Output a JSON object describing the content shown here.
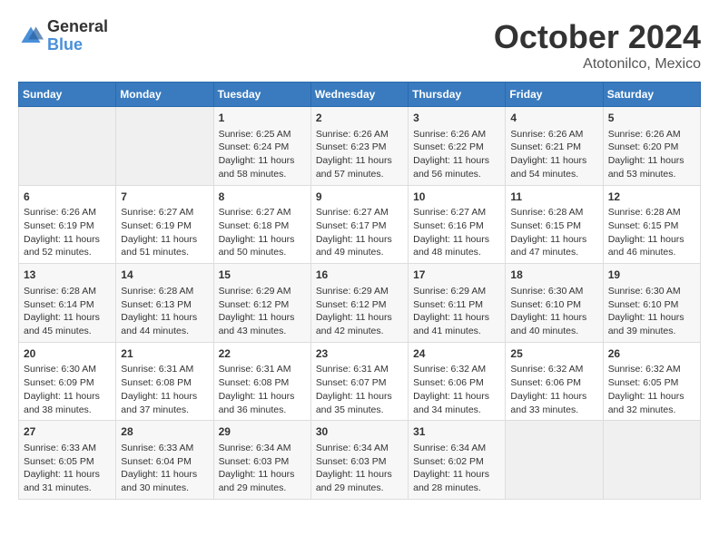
{
  "logo": {
    "general": "General",
    "blue": "Blue"
  },
  "title": "October 2024",
  "location": "Atotonilco, Mexico",
  "days_of_week": [
    "Sunday",
    "Monday",
    "Tuesday",
    "Wednesday",
    "Thursday",
    "Friday",
    "Saturday"
  ],
  "weeks": [
    [
      {
        "day": "",
        "content": ""
      },
      {
        "day": "",
        "content": ""
      },
      {
        "day": "1",
        "content": "Sunrise: 6:25 AM\nSunset: 6:24 PM\nDaylight: 11 hours and 58 minutes."
      },
      {
        "day": "2",
        "content": "Sunrise: 6:26 AM\nSunset: 6:23 PM\nDaylight: 11 hours and 57 minutes."
      },
      {
        "day": "3",
        "content": "Sunrise: 6:26 AM\nSunset: 6:22 PM\nDaylight: 11 hours and 56 minutes."
      },
      {
        "day": "4",
        "content": "Sunrise: 6:26 AM\nSunset: 6:21 PM\nDaylight: 11 hours and 54 minutes."
      },
      {
        "day": "5",
        "content": "Sunrise: 6:26 AM\nSunset: 6:20 PM\nDaylight: 11 hours and 53 minutes."
      }
    ],
    [
      {
        "day": "6",
        "content": "Sunrise: 6:26 AM\nSunset: 6:19 PM\nDaylight: 11 hours and 52 minutes."
      },
      {
        "day": "7",
        "content": "Sunrise: 6:27 AM\nSunset: 6:19 PM\nDaylight: 11 hours and 51 minutes."
      },
      {
        "day": "8",
        "content": "Sunrise: 6:27 AM\nSunset: 6:18 PM\nDaylight: 11 hours and 50 minutes."
      },
      {
        "day": "9",
        "content": "Sunrise: 6:27 AM\nSunset: 6:17 PM\nDaylight: 11 hours and 49 minutes."
      },
      {
        "day": "10",
        "content": "Sunrise: 6:27 AM\nSunset: 6:16 PM\nDaylight: 11 hours and 48 minutes."
      },
      {
        "day": "11",
        "content": "Sunrise: 6:28 AM\nSunset: 6:15 PM\nDaylight: 11 hours and 47 minutes."
      },
      {
        "day": "12",
        "content": "Sunrise: 6:28 AM\nSunset: 6:15 PM\nDaylight: 11 hours and 46 minutes."
      }
    ],
    [
      {
        "day": "13",
        "content": "Sunrise: 6:28 AM\nSunset: 6:14 PM\nDaylight: 11 hours and 45 minutes."
      },
      {
        "day": "14",
        "content": "Sunrise: 6:28 AM\nSunset: 6:13 PM\nDaylight: 11 hours and 44 minutes."
      },
      {
        "day": "15",
        "content": "Sunrise: 6:29 AM\nSunset: 6:12 PM\nDaylight: 11 hours and 43 minutes."
      },
      {
        "day": "16",
        "content": "Sunrise: 6:29 AM\nSunset: 6:12 PM\nDaylight: 11 hours and 42 minutes."
      },
      {
        "day": "17",
        "content": "Sunrise: 6:29 AM\nSunset: 6:11 PM\nDaylight: 11 hours and 41 minutes."
      },
      {
        "day": "18",
        "content": "Sunrise: 6:30 AM\nSunset: 6:10 PM\nDaylight: 11 hours and 40 minutes."
      },
      {
        "day": "19",
        "content": "Sunrise: 6:30 AM\nSunset: 6:10 PM\nDaylight: 11 hours and 39 minutes."
      }
    ],
    [
      {
        "day": "20",
        "content": "Sunrise: 6:30 AM\nSunset: 6:09 PM\nDaylight: 11 hours and 38 minutes."
      },
      {
        "day": "21",
        "content": "Sunrise: 6:31 AM\nSunset: 6:08 PM\nDaylight: 11 hours and 37 minutes."
      },
      {
        "day": "22",
        "content": "Sunrise: 6:31 AM\nSunset: 6:08 PM\nDaylight: 11 hours and 36 minutes."
      },
      {
        "day": "23",
        "content": "Sunrise: 6:31 AM\nSunset: 6:07 PM\nDaylight: 11 hours and 35 minutes."
      },
      {
        "day": "24",
        "content": "Sunrise: 6:32 AM\nSunset: 6:06 PM\nDaylight: 11 hours and 34 minutes."
      },
      {
        "day": "25",
        "content": "Sunrise: 6:32 AM\nSunset: 6:06 PM\nDaylight: 11 hours and 33 minutes."
      },
      {
        "day": "26",
        "content": "Sunrise: 6:32 AM\nSunset: 6:05 PM\nDaylight: 11 hours and 32 minutes."
      }
    ],
    [
      {
        "day": "27",
        "content": "Sunrise: 6:33 AM\nSunset: 6:05 PM\nDaylight: 11 hours and 31 minutes."
      },
      {
        "day": "28",
        "content": "Sunrise: 6:33 AM\nSunset: 6:04 PM\nDaylight: 11 hours and 30 minutes."
      },
      {
        "day": "29",
        "content": "Sunrise: 6:34 AM\nSunset: 6:03 PM\nDaylight: 11 hours and 29 minutes."
      },
      {
        "day": "30",
        "content": "Sunrise: 6:34 AM\nSunset: 6:03 PM\nDaylight: 11 hours and 29 minutes."
      },
      {
        "day": "31",
        "content": "Sunrise: 6:34 AM\nSunset: 6:02 PM\nDaylight: 11 hours and 28 minutes."
      },
      {
        "day": "",
        "content": ""
      },
      {
        "day": "",
        "content": ""
      }
    ]
  ]
}
